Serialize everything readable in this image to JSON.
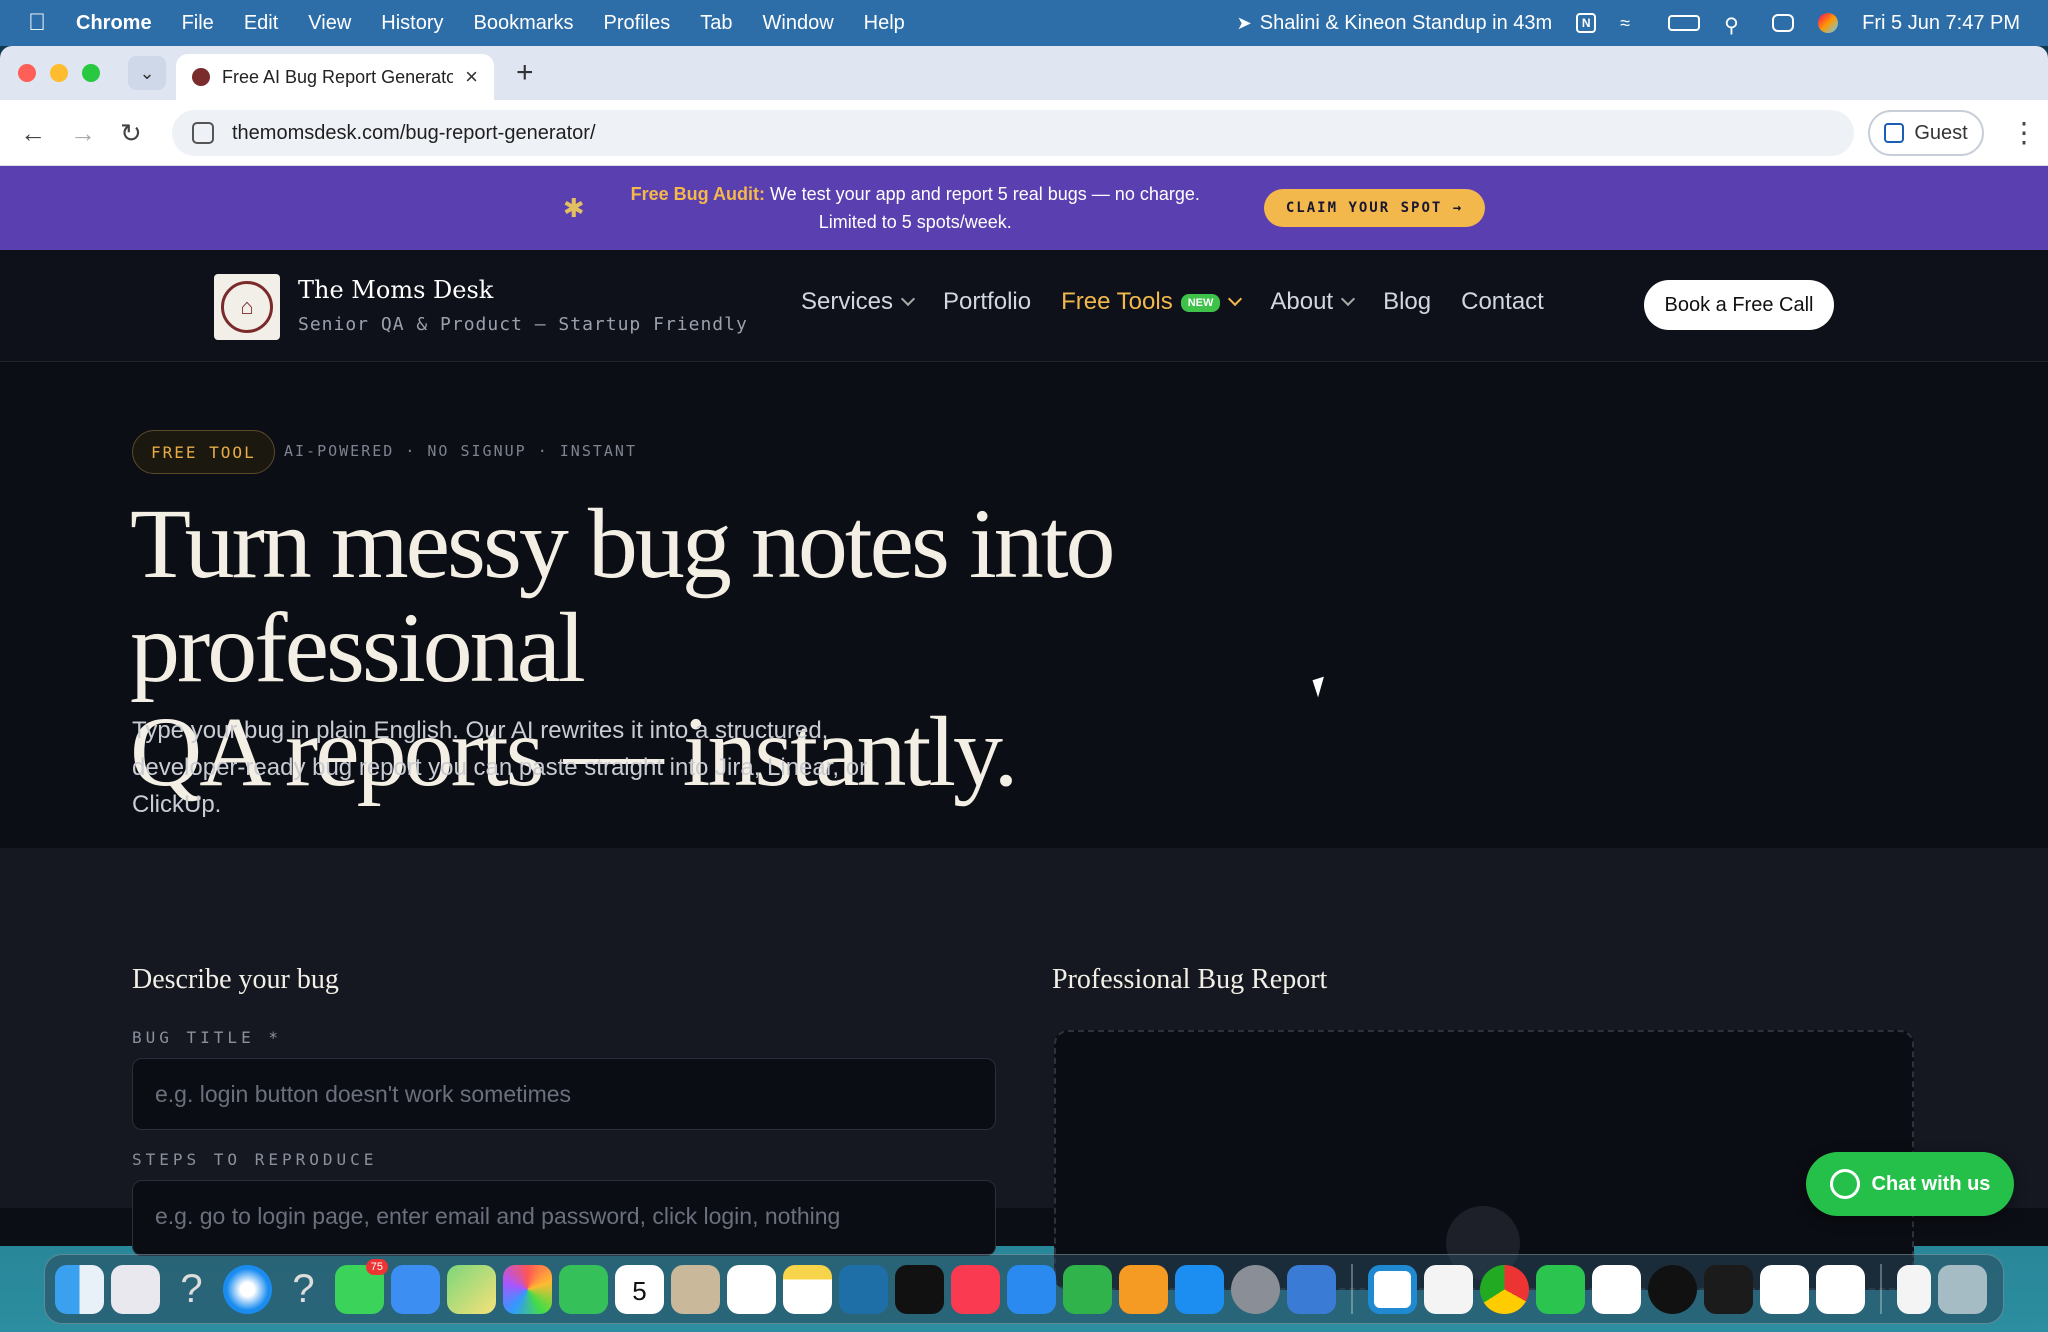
{
  "menubar": {
    "app": "Chrome",
    "menus": [
      "File",
      "Edit",
      "View",
      "History",
      "Bookmarks",
      "Profiles",
      "Tab",
      "Window",
      "Help"
    ],
    "meeting": "Shalini & Kineon Standup in 43m",
    "datetime": "Fri 5 Jun  7:47 PM"
  },
  "browser": {
    "tab_title": "Free AI Bug Report Generator",
    "url": "themomsdesk.com/bug-report-generator/",
    "profile": "Guest"
  },
  "promo": {
    "highlight": "Free Bug Audit:",
    "text": " We test your app and report 5 real bugs — no charge.",
    "text2": "Limited to 5 spots/week.",
    "cta": "CLAIM YOUR SPOT →"
  },
  "site": {
    "brand": "The Moms Desk",
    "brand_sub": "Senior QA & Product — Startup Friendly",
    "nav": {
      "services": "Services",
      "portfolio": "Portfolio",
      "free_tools": "Free Tools",
      "new_badge": "NEW",
      "about": "About",
      "blog": "Blog",
      "contact": "Contact"
    },
    "call_button": "Book a Free Call"
  },
  "hero": {
    "tag": "FREE TOOL",
    "tagline": "AI-POWERED · NO SIGNUP · INSTANT",
    "title_line1": "Turn messy bug notes into professional",
    "title_line2": "QA reports — instantly.",
    "subtitle": "Type your bug in plain English. Our AI rewrites it into a structured, developer-ready bug report you can paste straight into Jira, Linear, or ClickUp."
  },
  "form": {
    "left_title": "Describe your bug",
    "right_title": "Professional Bug Report",
    "bug_title_label": "BUG TITLE *",
    "bug_title_placeholder": "e.g. login button doesn't work sometimes",
    "steps_label": "STEPS TO REPRODUCE",
    "steps_placeholder": "e.g. go to login page, enter email and password, click login, nothing"
  },
  "chat": {
    "label": "Chat with us"
  },
  "dock": {
    "messages_badge": "75",
    "calendar_day": "5",
    "icons": [
      "finder-icon",
      "launchpad-icon",
      "unknown-icon",
      "safari-icon",
      "unknown-icon",
      "messages-icon",
      "mail-icon",
      "maps-icon",
      "photos-icon",
      "facetime-icon",
      "calendar-icon",
      "contacts-icon",
      "reminders-icon",
      "notes-icon",
      "freeform-icon",
      "tv-icon",
      "music-icon",
      "keynote-icon",
      "numbers-icon",
      "pages-icon",
      "app-store-icon",
      "system-settings-icon",
      "iphone-mirroring-icon",
      "vscode-icon",
      "textedit-icon",
      "chrome-icon",
      "whatsapp-icon",
      "slack-icon",
      "upwork-icon",
      "terminal-icon",
      "notion-icon",
      "arc-icon",
      "document-icon",
      "trash-icon"
    ]
  },
  "colors": {
    "promo_bg": "#5a3fb0",
    "accent_gold": "#f2b84b",
    "page_bg": "#0c0e16",
    "whatsapp_green": "#25c04a"
  }
}
